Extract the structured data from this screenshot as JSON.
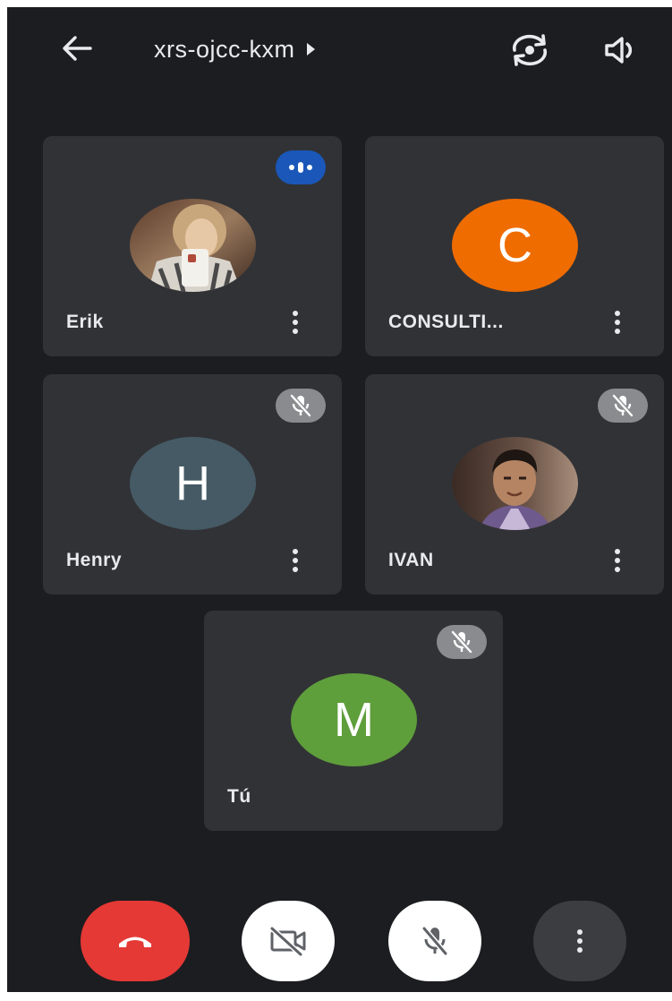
{
  "header": {
    "meeting_code": "xrs-ojcc-kxm",
    "back_icon": "arrow-left-icon",
    "expand_icon": "caret-right-icon",
    "switch_camera_icon": "camera-flip-icon",
    "speaker_icon": "speaker-icon"
  },
  "participants": [
    {
      "name": "Erik",
      "avatar_type": "photo",
      "status": "speaking",
      "status_color": "#1a57b8"
    },
    {
      "name": "CONSULTI...",
      "avatar_type": "initial",
      "initial": "C",
      "avatar_color": "#ef6c00",
      "status": "none"
    },
    {
      "name": "Henry",
      "avatar_type": "initial",
      "initial": "H",
      "avatar_color": "#455a64",
      "status": "muted"
    },
    {
      "name": "IVAN",
      "avatar_type": "photo",
      "status": "muted"
    },
    {
      "name": "Tú",
      "avatar_type": "initial",
      "initial": "M",
      "avatar_color": "#5e9e3b",
      "status": "muted"
    }
  ],
  "controls": {
    "end_call_icon": "phone-hangup-icon",
    "end_call_color": "#e53935",
    "camera_icon": "video-off-icon",
    "mic_icon": "mic-off-icon",
    "more_icon": "more-vertical-icon"
  },
  "colors": {
    "background": "#1c1d20",
    "tile": "#313236",
    "text": "#e8eaed"
  }
}
